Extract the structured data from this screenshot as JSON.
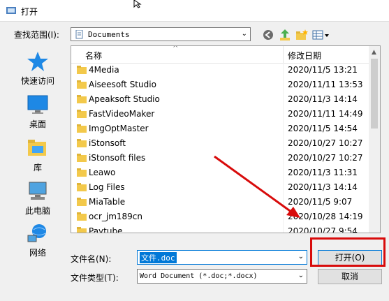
{
  "window": {
    "title": "打开"
  },
  "lookin": {
    "label": "查找范围(I):",
    "value": "Documents"
  },
  "places": [
    {
      "label": "快速访问",
      "icon": "star-icon"
    },
    {
      "label": "桌面",
      "icon": "desktop-icon"
    },
    {
      "label": "库",
      "icon": "library-icon"
    },
    {
      "label": "此电脑",
      "icon": "computer-icon"
    },
    {
      "label": "网络",
      "icon": "network-icon"
    }
  ],
  "list": {
    "headers": {
      "name": "名称",
      "date": "修改日期"
    },
    "rows": [
      {
        "name": "4Media",
        "date": "2020/11/5 13:21"
      },
      {
        "name": "Aiseesoft Studio",
        "date": "2020/11/11 13:53"
      },
      {
        "name": "Apeaksoft Studio",
        "date": "2020/11/3 14:14"
      },
      {
        "name": "FastVideoMaker",
        "date": "2020/11/11 14:49"
      },
      {
        "name": "ImgOptMaster",
        "date": "2020/11/5 14:54"
      },
      {
        "name": "iStonsoft",
        "date": "2020/10/27 10:27"
      },
      {
        "name": "iStonsoft files",
        "date": "2020/10/27 10:27"
      },
      {
        "name": "Leawo",
        "date": "2020/11/3 11:31"
      },
      {
        "name": "Log Files",
        "date": "2020/11/3 14:14"
      },
      {
        "name": "MiaTable",
        "date": "2020/11/5 9:07"
      },
      {
        "name": "ocr_jm189cn",
        "date": "2020/10/28 14:19"
      },
      {
        "name": "Paytube",
        "date": "2020/10/27 9:54"
      }
    ]
  },
  "filename": {
    "label": "文件名(N):",
    "value": "文件.doc"
  },
  "filetype": {
    "label": "文件类型(T):",
    "value": "Word Document (*.doc;*.docx)"
  },
  "buttons": {
    "open": "打开(O)",
    "cancel": "取消"
  },
  "colors": {
    "accent": "#0078d7",
    "folder": "#f3c94b",
    "highlight": "#d80b0b"
  }
}
